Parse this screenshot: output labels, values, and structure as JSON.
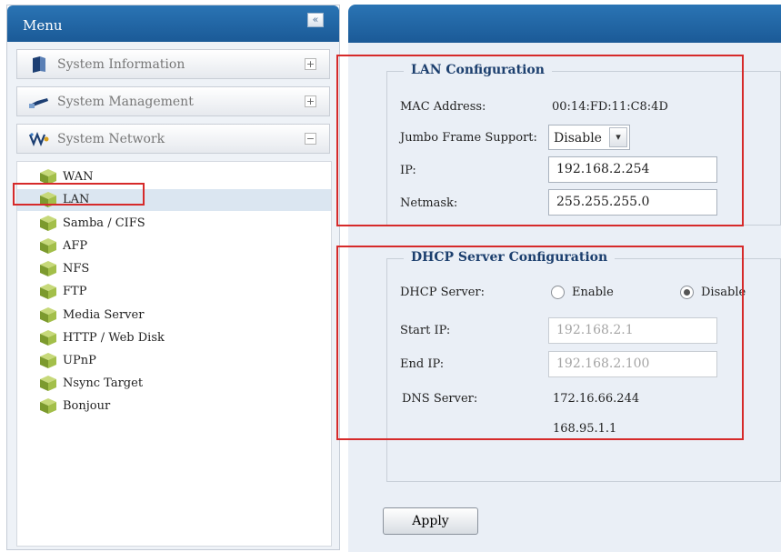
{
  "menu": {
    "title": "Menu",
    "collapse_glyph": "«",
    "groups": [
      {
        "label": "System Information",
        "toggle": "+",
        "icon": "book-icon"
      },
      {
        "label": "System Management",
        "toggle": "+",
        "icon": "tool-icon"
      },
      {
        "label": "System Network",
        "toggle": "−",
        "icon": "network-icon"
      }
    ],
    "network_items": [
      {
        "label": "WAN"
      },
      {
        "label": "LAN"
      },
      {
        "label": "Samba / CIFS"
      },
      {
        "label": "AFP"
      },
      {
        "label": "NFS"
      },
      {
        "label": "FTP"
      },
      {
        "label": "Media Server"
      },
      {
        "label": "HTTP / Web Disk"
      },
      {
        "label": "UPnP"
      },
      {
        "label": "Nsync Target"
      },
      {
        "label": "Bonjour"
      }
    ],
    "active_item": "LAN"
  },
  "lan": {
    "legend": "LAN Configuration",
    "mac_label": "MAC Address:",
    "mac_value": "00:14:FD:11:C8:4D",
    "jumbo_label": "Jumbo Frame Support:",
    "jumbo_value": "Disable",
    "ip_label": "IP:",
    "ip_value": "192.168.2.254",
    "netmask_label": "Netmask:",
    "netmask_value": "255.255.255.0"
  },
  "dhcp": {
    "legend": "DHCP Server Configuration",
    "server_label": "DHCP Server:",
    "enable_label": "Enable",
    "disable_label": "Disable",
    "selected": "Disable",
    "start_ip_label": "Start IP:",
    "start_ip_value": "192.168.2.1",
    "end_ip_label": "End IP:",
    "end_ip_value": "192.168.2.100",
    "dns_label": "DNS Server:",
    "dns_values": [
      "172.16.66.244",
      "168.95.1.1"
    ]
  },
  "apply_label": "Apply",
  "colors": {
    "header_blue": "#1b5a97",
    "highlight_red": "#d62a2a",
    "legend_text": "#1c3f6e",
    "content_bg": "#eaeff6"
  }
}
